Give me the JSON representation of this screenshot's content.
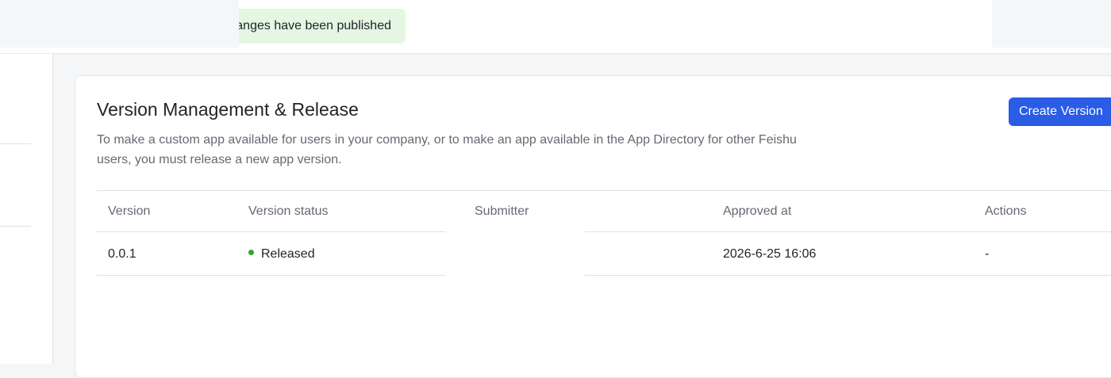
{
  "toast": {
    "message": "anges have been published"
  },
  "page": {
    "title": "Version Management & Release",
    "description": "To make a custom app available for users in your company, or to make an app available in the App Directory for other Feishu users, you must release a new app version.",
    "create_button_label": "Create Version"
  },
  "table": {
    "headers": {
      "version": "Version",
      "status": "Version status",
      "submitter": "Submitter",
      "approved_at": "Approved at",
      "actions": "Actions"
    },
    "rows": [
      {
        "version": "0.0.1",
        "status": "Released",
        "submitter": "",
        "approved_at": "2026-6-25 16:06",
        "actions": "-"
      }
    ]
  },
  "colors": {
    "primary_button": "#2a5ce6",
    "toast_background": "#e5f6e3",
    "status_released": "#34a42a"
  }
}
